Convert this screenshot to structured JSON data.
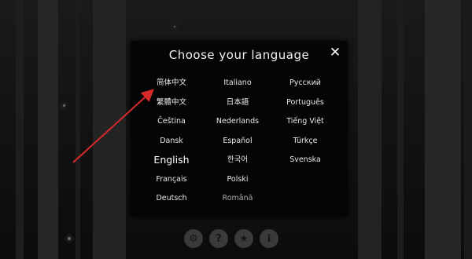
{
  "dialog": {
    "title": "Choose your language",
    "close_icon": "close-icon"
  },
  "languages": [
    [
      "简体中文",
      "Italiano",
      "Русский"
    ],
    [
      "繁體中文",
      "日本語",
      "Português"
    ],
    [
      "Čeština",
      "Nederlands",
      "Tiếng Việt"
    ],
    [
      "Dansk",
      "Español",
      "Türkçe"
    ],
    [
      "English",
      "한국어",
      "Svenska"
    ],
    [
      "Français",
      "Polski",
      ""
    ],
    [
      "Deutsch",
      "Română",
      ""
    ]
  ],
  "selected_language": "English",
  "toolbar": {
    "icons": [
      "settings-icon",
      "help-icon",
      "star-icon",
      "info-icon"
    ],
    "glyphs": [
      "⚙",
      "?",
      "★",
      "i"
    ]
  },
  "colors": {
    "dialog_bg": "#050505",
    "text": "#e8e8e8",
    "annotation_arrow": "#d62a2a"
  }
}
